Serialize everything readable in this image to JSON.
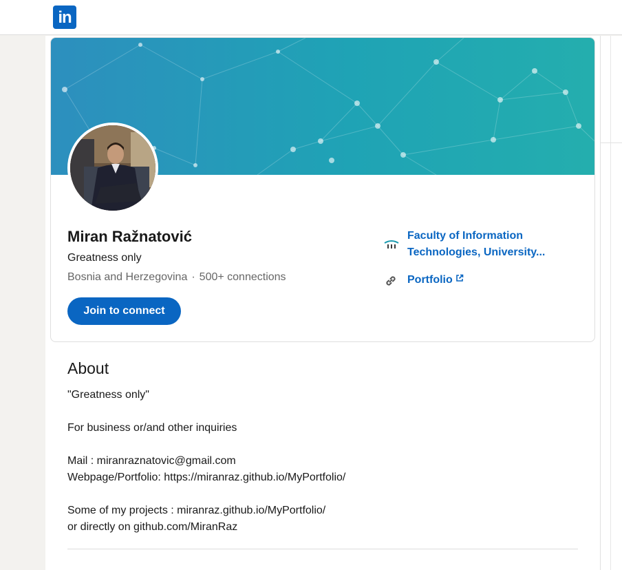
{
  "brand": {
    "logo_text": "in",
    "accent": "#0a66c2"
  },
  "profile": {
    "name": "Miran Ražnatović",
    "headline": "Greatness only",
    "location": "Bosnia and Herzegovina",
    "separator": "·",
    "connections": "500+ connections",
    "join_label": "Join to connect"
  },
  "sidebar_info": {
    "education": {
      "label": "Faculty of Information Technologies, University...",
      "icon": "school-logo-icon"
    },
    "portfolio": {
      "label": "Portfolio",
      "icon": "link-icon",
      "external_icon": "external-link-icon"
    }
  },
  "about": {
    "title": "About",
    "body": "\"Greatness only\"\n\nFor business or/and other inquiries\n\nMail : miranraznatovic@gmail.com\nWebpage/Portfolio: https://miranraz.github.io/MyPortfolio/\n\nSome of my projects : miranraz.github.io/MyPortfolio/\nor directly on github.com/MiranRaz"
  }
}
